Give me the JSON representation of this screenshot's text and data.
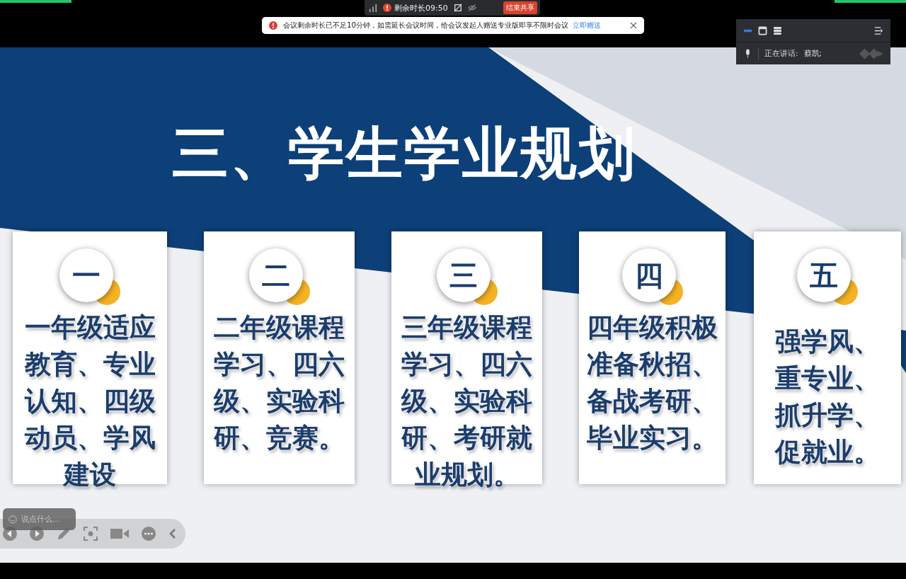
{
  "meeting_bar": {
    "remaining": "剩余时长09:50",
    "stop_share": "结束共享"
  },
  "notice": {
    "message": "会议剩余时长已不足10分钟，如需延长会议时间，给会议发起人赠送专业版即享不限时会议",
    "link": "立即赠送"
  },
  "speaker_panel": {
    "label": "正在讲话:",
    "name": "蔡凯;"
  },
  "slide": {
    "title": "三、学生学业规划",
    "cards": [
      {
        "numeral": "一",
        "text": "一年级适应教育、专业认知、四级动员、学风建设"
      },
      {
        "numeral": "二",
        "text": "二年级课程学习、四六级、实验科研、竞赛。"
      },
      {
        "numeral": "三",
        "text": "三年级课程学习、四六级、实验科研、考研就业规划。"
      },
      {
        "numeral": "四",
        "text": "四年级积极准备秋招、备战考研、毕业实习。"
      },
      {
        "numeral": "五",
        "text": "强学风、重专业、抓升学、促就业。"
      }
    ]
  },
  "chat": {
    "placeholder": "说点什么..."
  }
}
